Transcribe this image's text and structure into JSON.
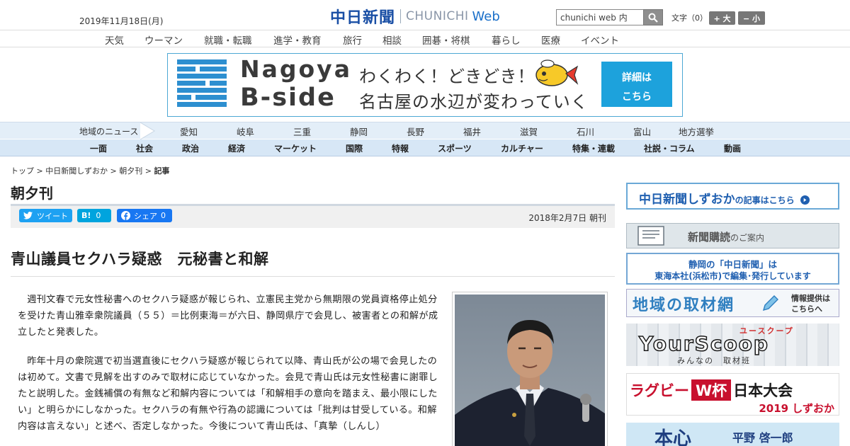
{
  "header": {
    "date": "2019年11月18日(月)",
    "logo_ja": "中日新聞",
    "logo_en": "CHUNICHI",
    "logo_web": "Web",
    "search_value": "chunichi web 内",
    "font_label": "文字（0）",
    "font_bigger": "+ 大",
    "font_smaller": "− 小"
  },
  "top_nav": [
    "天気",
    "ウーマン",
    "就職・転職",
    "進学・教育",
    "旅行",
    "相談",
    "囲碁・将棋",
    "暮らし",
    "医療",
    "イベント"
  ],
  "banner": {
    "title1": "Nagoya",
    "title2": "B-side",
    "copy1": "わくわく！どきどき！",
    "copy2": "名古屋の水辺が変わっていく",
    "detail1": "詳細は",
    "detail2": "こちら"
  },
  "regional_nav": {
    "label": "地域のニュース",
    "items": [
      "愛知",
      "岐阜",
      "三重",
      "静岡",
      "長野",
      "福井",
      "滋賀",
      "石川",
      "富山",
      "地方選挙"
    ]
  },
  "category_nav": [
    "一面",
    "社会",
    "政治",
    "経済",
    "マーケット",
    "国際",
    "特報",
    "スポーツ",
    "カルチャー",
    "特集・連載",
    "社説・コラム",
    "動画"
  ],
  "breadcrumb": {
    "top": "トップ",
    "shizuoka": "中日新聞しずおか",
    "chouyuukan": "朝夕刊",
    "article": "記事",
    "sep": " > "
  },
  "section_title": "朝夕刊",
  "share": {
    "tweet": "ツイート",
    "hatena": "B!",
    "hatena_count": "0",
    "fb": "シェア",
    "fb_count": "0"
  },
  "pubdate": "2018年2月7日 朝刊",
  "headline": "青山議員セクハラ疑惑　元秘書と和解",
  "article": [
    "週刊文春で元女性秘書へのセクハラ疑惑が報じられ、立憲民主党から無期限の党員資格停止処分を受けた青山雅幸衆院議員（５５）＝比例東海＝が六日、静岡県庁で会見し、被害者との和解が成立したと発表した。",
    "昨年十月の衆院選で初当選直後にセクハラ疑惑が報じられて以降、青山氏が公の場で会見したのは初めて。文書で見解を出すのみで取材に応じていなかった。会見で青山氏は元女性秘書に謝罪したと説明した。金銭補償の有無など和解内容については「和解相手の意向を踏まえ、最小限にしたい」と明らかにしなかった。セクハラの有無や行為の認識については「批判は甘受している。和解内容は言えない」と述べ、否定しなかった。今後について青山氏は、「真摯（しんし）"
  ],
  "sidebar": {
    "s1_main": "中日新聞しずおか",
    "s1_sub": "の記事はこちら",
    "s2_main": "新聞購読",
    "s2_sub": "のご案内",
    "s3_line1": "静岡の「中日新聞」は",
    "s3_line2": "東海本社(浜松市)で編集･発行しています",
    "s4_main": "地域の取材網",
    "s4_sub1": "情報提供は",
    "s4_sub2": "こちらへ",
    "s5_main": "YourScoop",
    "s5_small": "ユースクープ",
    "s5_sub": "みんなの　取材班",
    "s6_a": "ラグビー",
    "s6_b": "W杯",
    "s6_c": "日本大会",
    "s6_d": "2019 しずおか",
    "s7_main": "本心",
    "s7_sub": "平野 啓一郎"
  },
  "colors": {
    "brand_blue": "#1a4fa5",
    "nav_blue": "#d7e7f6",
    "banner_blue": "#1da2dc",
    "tweet": "#1da1f2",
    "hatena": "#00a4de",
    "facebook": "#1877f2"
  }
}
